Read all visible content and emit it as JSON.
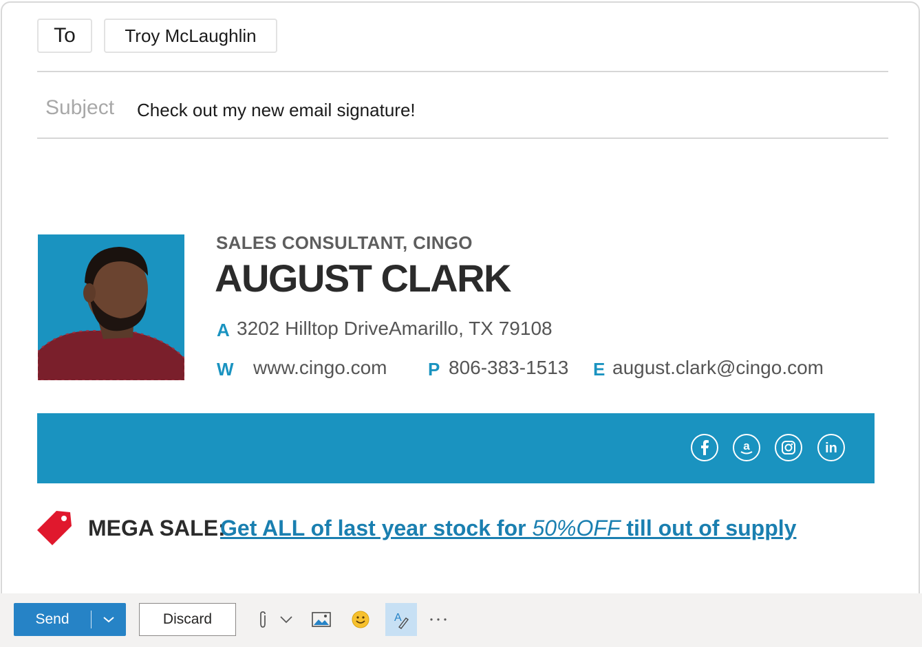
{
  "compose": {
    "to_label": "To",
    "recipient": "Troy McLaughlin",
    "subject_label": "Subject",
    "subject_value": "Check out my new email signature!"
  },
  "signature": {
    "role": "SALES CONSULTANT, CINGO",
    "name": "AUGUST CLARK",
    "address_label": "A",
    "address": "3202 Hilltop DriveAmarillo, TX 79108",
    "website_label": "W",
    "website": "www.cingo.com",
    "phone_label": "P",
    "phone": "806-383-1513",
    "email_label": "E",
    "email": "august.clark@cingo.com",
    "banner_color": "#1a93c0",
    "social_icons": [
      "facebook-icon",
      "amazon-icon",
      "instagram-icon",
      "linkedin-icon"
    ]
  },
  "promo": {
    "label": "MEGA SALE:",
    "link_part1": "Get ALL of last year stock for ",
    "link_italic": "50%OFF",
    "link_part2": " till out of supply",
    "tag_color": "#e0182d"
  },
  "toolbar": {
    "send_label": "Send",
    "discard_label": "Discard",
    "icons": [
      "attach-icon",
      "chevron-down-icon",
      "image-icon",
      "emoji-icon",
      "format-text-icon",
      "more-icon"
    ]
  }
}
